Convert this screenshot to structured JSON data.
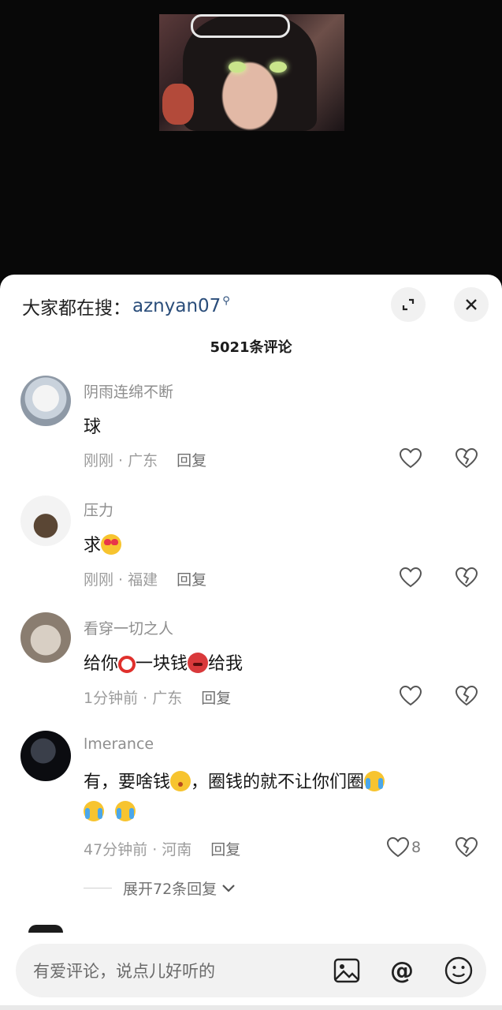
{
  "search_hint": {
    "label": "大家都在搜：",
    "keyword": "aznyan07"
  },
  "comment_count": "5021条评论",
  "comments": [
    {
      "username": "阴雨连绵不断",
      "text": "球",
      "time": "刚刚 · 广东",
      "reply": "回复",
      "likes": ""
    },
    {
      "username": "压力",
      "text": "求",
      "time": "刚刚 · 福建",
      "reply": "回复",
      "likes": ""
    },
    {
      "username": "看穿一切之人",
      "text_parts": [
        "给你",
        "一块钱",
        "给我"
      ],
      "time": "1分钟前 · 广东",
      "reply": "回复",
      "likes": ""
    },
    {
      "username": "lmerance",
      "text_parts": [
        "有，要啥钱",
        "，圈钱的就不让你们圈"
      ],
      "time": "47分钟前 · 河南",
      "reply": "回复",
      "likes": "8"
    }
  ],
  "expand_replies": "展开72条回复",
  "input": {
    "placeholder": "有爱评论，说点儿好听的"
  },
  "icons": [
    "expand-icon",
    "close-icon",
    "heart-icon",
    "broken-heart-icon",
    "image-icon",
    "at-icon",
    "emoji-icon",
    "search-icon",
    "chevron-down-icon"
  ]
}
